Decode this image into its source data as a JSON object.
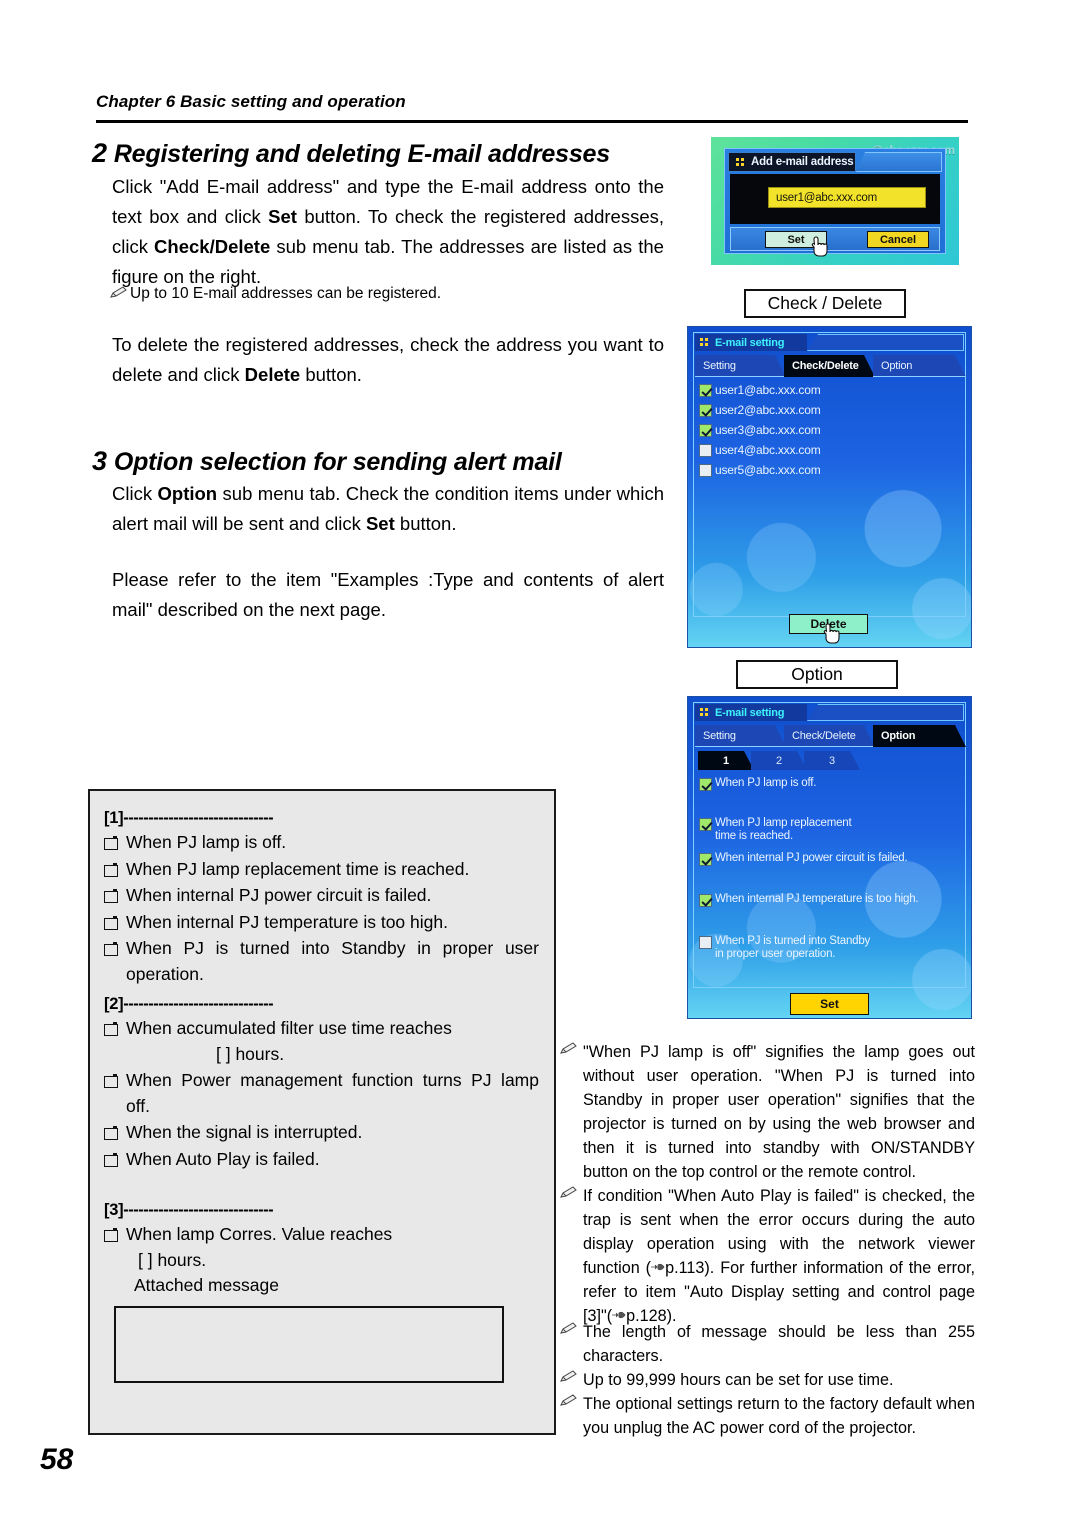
{
  "header": {
    "chapter": "Chapter 6",
    "title": "Basic setting and operation"
  },
  "page_number": "58",
  "sections": [
    {
      "number": "2",
      "title": "Registering and deleting E-mail addresses",
      "paragraph": "Click \"Add E-mail address\" and type the E-mail address onto the text box and click Set button. To check the registered addresses, click Check/Delete sub menu tab. The addresses are listed as the figure on the right.",
      "note": "Up to 10 E-mail addresses can be registered.",
      "paragraph2": "To delete the registered addresses, check the address you want to delete and click Delete button."
    },
    {
      "number": "3",
      "title": "Option selection for sending alert mail",
      "paragraph": "Click Option sub menu tab. Check the condition items under which alert mail will be sent and click Set button.",
      "paragraph2": "Please refer to the item \"Examples :Type and contents of alert mail\" described on the next page."
    }
  ],
  "condition_box": {
    "groups": [
      {
        "label": "[1]",
        "dashes": "------------------------------",
        "items": [
          "When PJ lamp is off.",
          "When PJ lamp replacement time is reached.",
          "When internal PJ power circuit is failed.",
          "When internal PJ temperature is too high.",
          "When PJ is turned into Standby in proper user operation."
        ]
      },
      {
        "label": "[2]",
        "dashes": "------------------------------",
        "items": [
          "When accumulated filter use time reaches",
          "When Power management function turns PJ lamp off.",
          "When the signal is interrupted.",
          "When Auto Play is failed."
        ],
        "hours_line": "[    ] hours."
      },
      {
        "label": "[3]",
        "dashes": "------------------------------",
        "items": [
          "When lamp Corres. Value reaches"
        ],
        "hours_line": "[    ] hours.",
        "attached_label": "Attached message"
      }
    ]
  },
  "figures": {
    "add_dialog": {
      "background_text": "@abc.xxx.com",
      "title": "Add e-mail address",
      "input_value": "user1@abc.xxx.com",
      "set_label": "Set",
      "cancel_label": "Cancel"
    },
    "label_check_delete": "Check / Delete",
    "label_option": "Option",
    "check_delete_panel": {
      "window_title": "E-mail setting",
      "tabs": [
        {
          "label": "Setting",
          "active": false
        },
        {
          "label": "Check/Delete",
          "active": true
        },
        {
          "label": "Option",
          "active": false
        }
      ],
      "addresses": [
        {
          "email": "user1@abc.xxx.com",
          "checked": true
        },
        {
          "email": "user2@abc.xxx.com",
          "checked": true
        },
        {
          "email": "user3@abc.xxx.com",
          "checked": true
        },
        {
          "email": "user4@abc.xxx.com",
          "checked": false
        },
        {
          "email": "user5@abc.xxx.com",
          "checked": false
        }
      ],
      "delete_label": "Delete"
    },
    "option_panel": {
      "window_title": "E-mail setting",
      "tabs": [
        {
          "label": "Setting",
          "active": false
        },
        {
          "label": "Check/Delete",
          "active": false
        },
        {
          "label": "Option",
          "active": true
        }
      ],
      "subtabs": [
        {
          "label": "1",
          "active": true
        },
        {
          "label": "2",
          "active": false
        },
        {
          "label": "3",
          "active": false
        }
      ],
      "conditions": [
        {
          "text": "When PJ lamp is off.",
          "checked": true
        },
        {
          "text": "When PJ lamp replacement time is reached.",
          "checked": true
        },
        {
          "text": "When internal PJ power circuit is failed.",
          "checked": true
        },
        {
          "text": "When internal PJ temperature is too high.",
          "checked": true
        },
        {
          "text": "When PJ is turned into Standby in proper user operation.",
          "checked": false
        }
      ],
      "set_label": "Set"
    }
  },
  "right_notes": [
    "\"When PJ lamp is off\" signifies the lamp goes out without user operation. \"When PJ is turned into Standby  in proper user operation\" signifies that the projector is turned on by using the web browser and then it is turned into standby with ON/STANDBY button on the top control or the remote control.",
    "If condition \"When Auto Play is failed\" is checked, the trap is sent when the error occurs during the auto display operation using with the network viewer function (",
    "p.113). For further information of the error, refer to item \"Auto Display setting and control page [3]\"(",
    "p.128).",
    "The length of message should be less than 255 characters.",
    "Up to 99,999 hours can be set for use time.",
    "The optional settings return to the factory default when you unplug the AC power cord of the projector."
  ],
  "colors": {
    "panel_blue": "#1d63e2",
    "accent_cyan": "#3ff3ff",
    "yellow": "#ffd400",
    "green_button": "#8ef0c8",
    "box_gray": "#e8e8e8"
  }
}
